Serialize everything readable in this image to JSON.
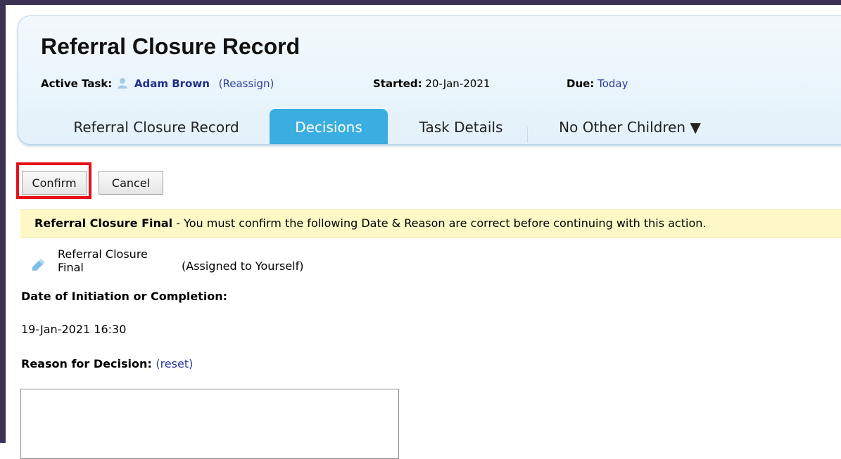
{
  "header": {
    "title": "Referral Closure Record",
    "active_task_label": "Active Task:",
    "assignee": "Adam Brown",
    "reassign_link": "(Reassign)",
    "started_label": "Started:",
    "started_value": "20-Jan-2021",
    "due_label": "Due:",
    "due_value": "Today"
  },
  "tabs": [
    {
      "label": "Referral Closure Record",
      "active": false
    },
    {
      "label": "Decisions",
      "active": true
    },
    {
      "label": "Task Details",
      "active": false
    },
    {
      "label": "No Other Children ▼",
      "active": false
    }
  ],
  "actions": {
    "confirm_label": "Confirm",
    "cancel_label": "Cancel"
  },
  "notice": {
    "title": "Referral Closure Final",
    "message": " - You must confirm the following Date & Reason are correct before continuing with this action."
  },
  "decision": {
    "name": "Referral Closure Final",
    "assigned_note": "(Assigned to Yourself)",
    "date_label": "Date of Initiation or Completion:",
    "date_value": "19-Jan-2021 16:30",
    "reason_label": "Reason for Decision:",
    "reset_link": "(reset)",
    "reason_value": ""
  },
  "colors": {
    "frame": "#3a3250",
    "active_tab": "#3aaee0",
    "link": "#2b3a9c",
    "highlight": "#e5101a",
    "notice_bg": "#fdf8c6"
  },
  "icons": [
    "person-icon",
    "pencil-icon",
    "dropdown-caret-icon"
  ]
}
